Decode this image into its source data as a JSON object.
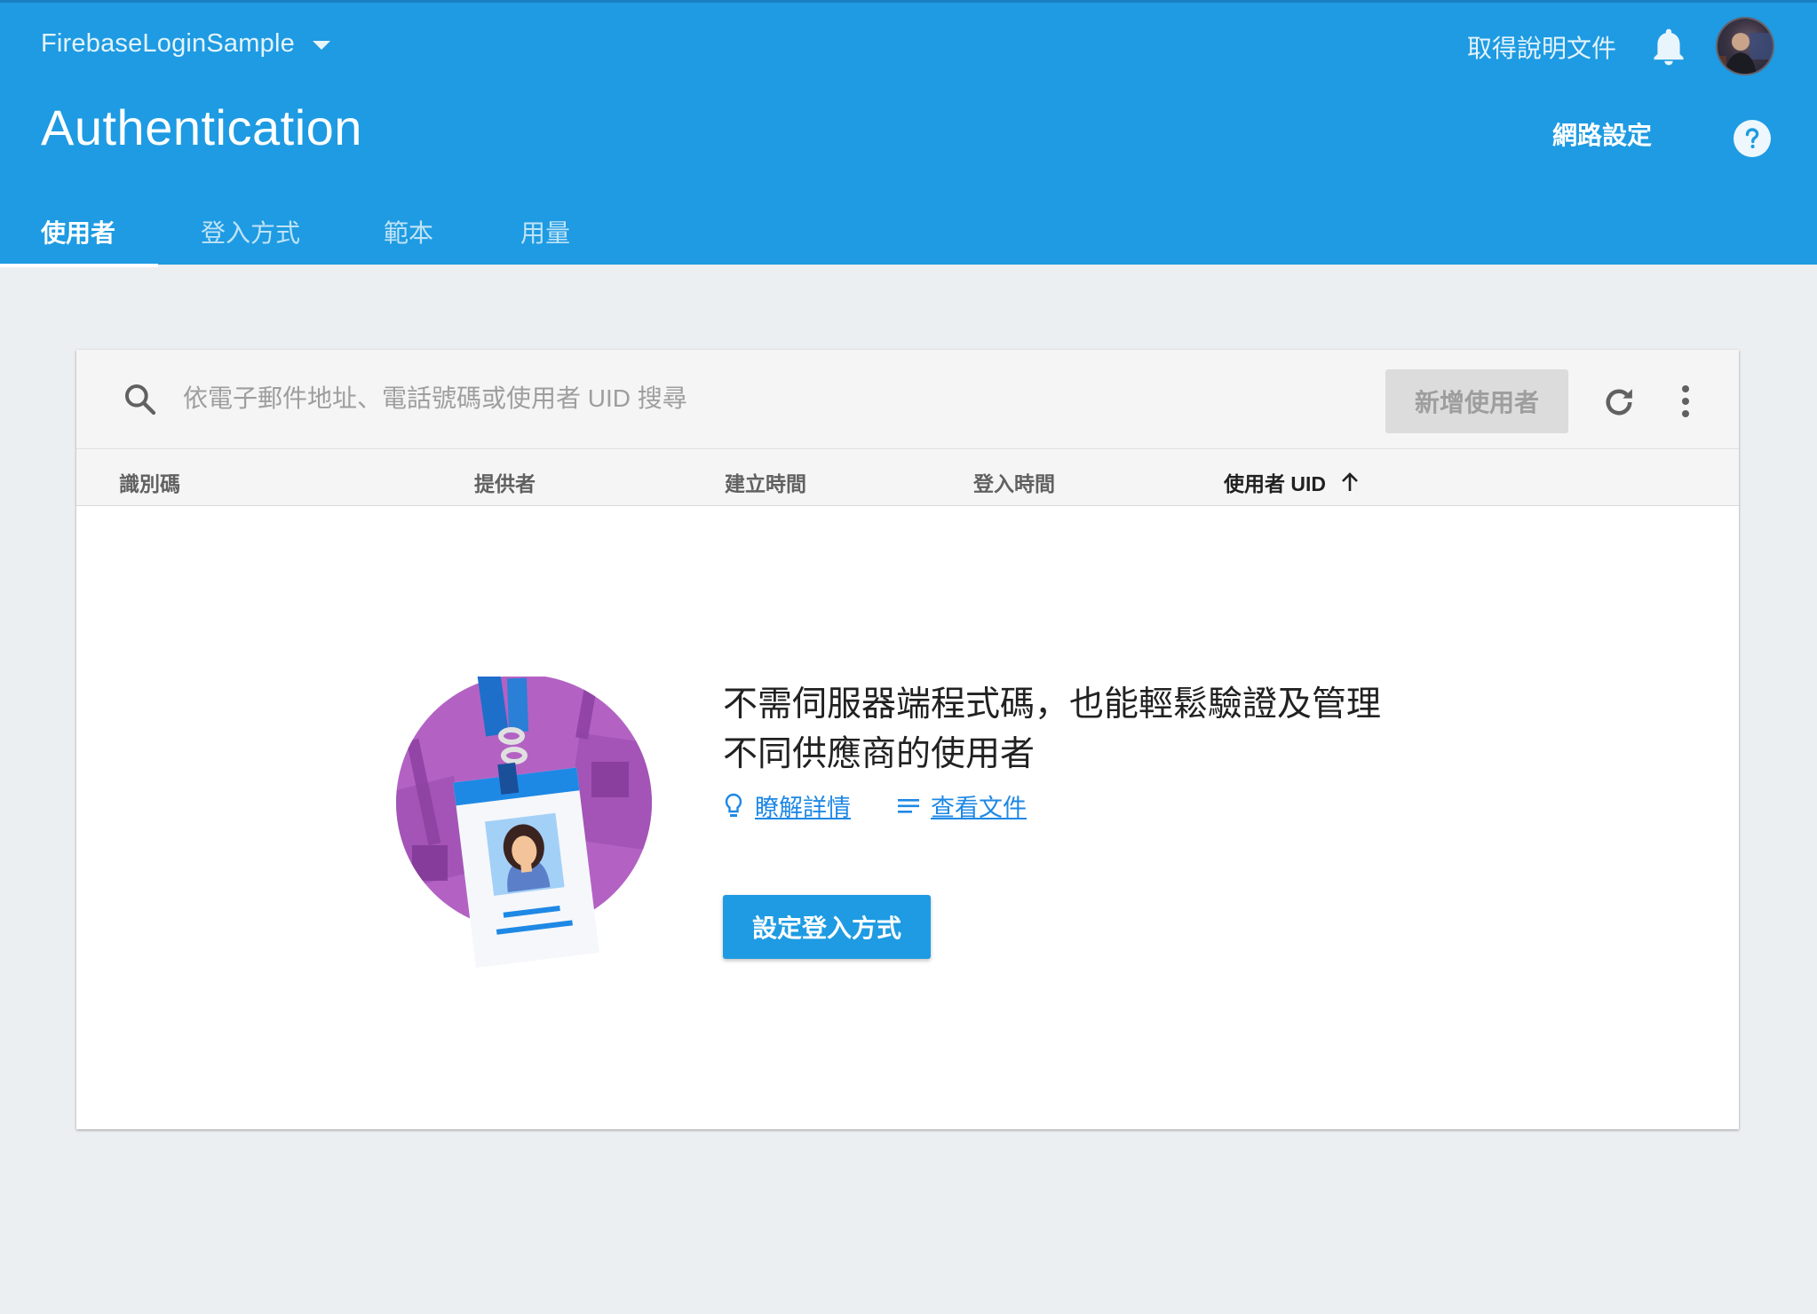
{
  "header": {
    "project_name": "FirebaseLoginSample",
    "page_title": "Authentication",
    "help_docs": "取得說明文件",
    "network_settings": "網路設定",
    "color": "#1e9be2"
  },
  "tabs": [
    {
      "label": "使用者",
      "active": true
    },
    {
      "label": "登入方式",
      "active": false
    },
    {
      "label": "範本",
      "active": false
    },
    {
      "label": "用量",
      "active": false
    }
  ],
  "toolbar": {
    "search_placeholder": "依電子郵件地址、電話號碼或使用者 UID 搜尋",
    "add_user_label": "新增使用者"
  },
  "table": {
    "columns": [
      "識別碼",
      "提供者",
      "建立時間",
      "登入時間",
      "使用者 UID"
    ],
    "sorted_column": "使用者 UID",
    "sort_direction": "ascending"
  },
  "empty_state": {
    "title_line1": "不需伺服器端程式碼，也能輕鬆驗證及管理",
    "title_line2": "不同供應商的使用者",
    "learn_more": "瞭解詳情",
    "view_docs": "查看文件",
    "setup_button": "設定登入方式"
  },
  "icons": {
    "project_caret": "caret-down-icon",
    "notifications": "bell-icon",
    "user": "avatar",
    "help": "help-circle-icon",
    "search": "search-icon",
    "refresh": "refresh-icon",
    "more": "more-vert-icon",
    "sort": "arrow-up-icon",
    "learn_more": "lightbulb-icon",
    "docs": "doc-lines-icon"
  }
}
